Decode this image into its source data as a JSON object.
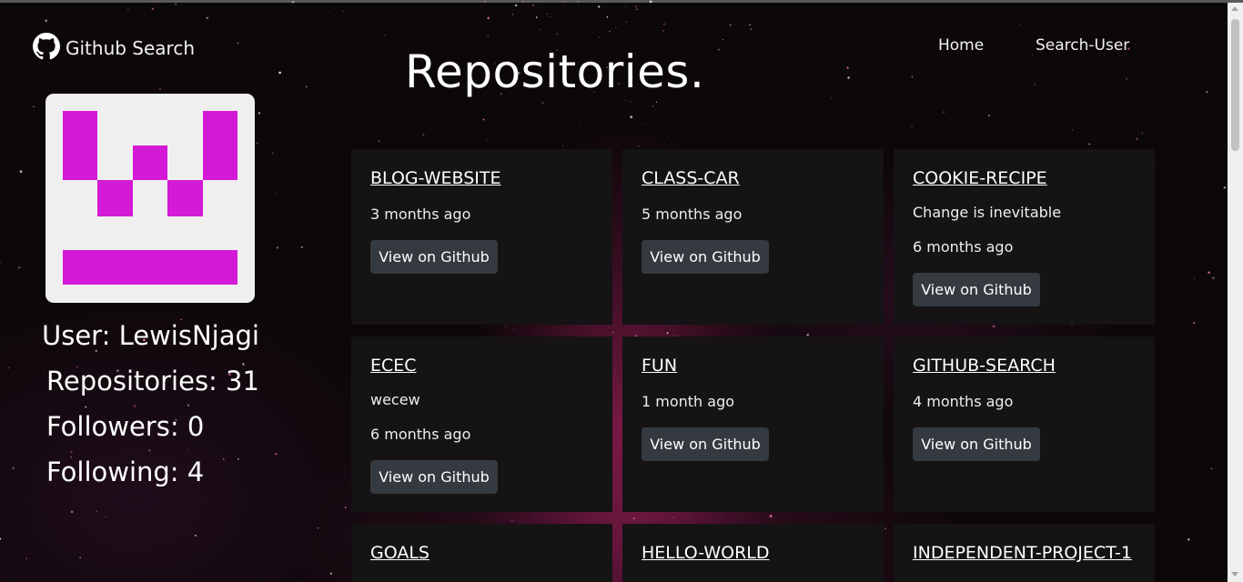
{
  "navbar": {
    "brand_icon": "github-icon",
    "brand_text": "Github Search",
    "links": [
      "Home",
      "Search-User"
    ]
  },
  "page_title": "Repositories.",
  "profile": {
    "avatar_colors": {
      "foreground": "#d41ad6",
      "background": "#f0eff0"
    },
    "user": "User: LewisNjagi",
    "repositories": "Repositories: 31",
    "followers": "Followers: 0",
    "following": "Following: 4"
  },
  "repos": [
    {
      "name": "BLOG-WEBSITE",
      "description": "",
      "updated": "3 months ago",
      "button": "View on Github"
    },
    {
      "name": "CLASS-CAR",
      "description": "",
      "updated": "5 months ago",
      "button": "View on Github"
    },
    {
      "name": "COOKIE-RECIPE",
      "description": "Change is inevitable",
      "updated": "6 months ago",
      "button": "View on Github"
    },
    {
      "name": "ECEC",
      "description": "wecew",
      "updated": "6 months ago",
      "button": "View on Github"
    },
    {
      "name": "FUN",
      "description": "",
      "updated": "1 month ago",
      "button": "View on Github"
    },
    {
      "name": "GITHUB-SEARCH",
      "description": "",
      "updated": "4 months ago",
      "button": "View on Github"
    },
    {
      "name": "GOALS",
      "description": "",
      "updated": "",
      "button": ""
    },
    {
      "name": "HELLO-WORLD",
      "description": "",
      "updated": "",
      "button": ""
    },
    {
      "name": "INDEPENDENT-PROJECT-1",
      "description": "",
      "updated": "",
      "button": ""
    }
  ],
  "colors": {
    "card_bg": "#151314",
    "button_bg": "#343a40",
    "accent": "#d41ad6"
  }
}
